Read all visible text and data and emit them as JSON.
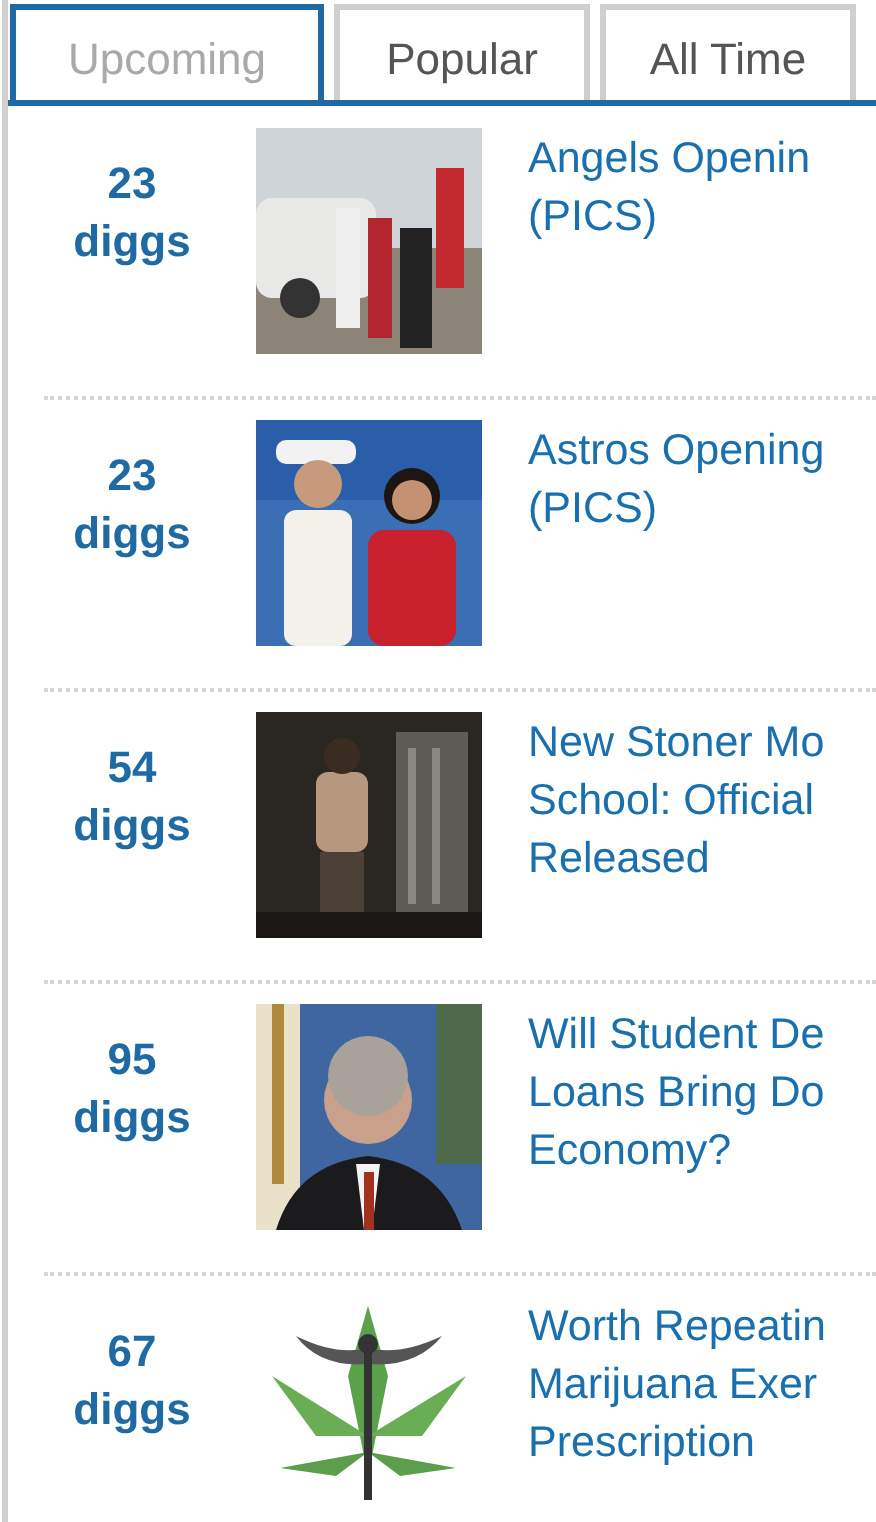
{
  "tabs": [
    {
      "label": "Upcoming",
      "selected": true
    },
    {
      "label": "Popular",
      "selected": false
    },
    {
      "label": "All Time",
      "selected": false
    }
  ],
  "stories": [
    {
      "count": "23",
      "unit": "diggs",
      "title": "Angels Openin\n(PICS)"
    },
    {
      "count": "23",
      "unit": "diggs",
      "title": "Astros Opening\n(PICS)"
    },
    {
      "count": "54",
      "unit": "diggs",
      "title": "New Stoner Mo\nSchool: Official\nReleased"
    },
    {
      "count": "95",
      "unit": "diggs",
      "title": "Will Student De\nLoans Bring Do\nEconomy?"
    },
    {
      "count": "67",
      "unit": "diggs",
      "title": "Worth Repeatin\nMarijuana Exer\nPrescription"
    }
  ]
}
